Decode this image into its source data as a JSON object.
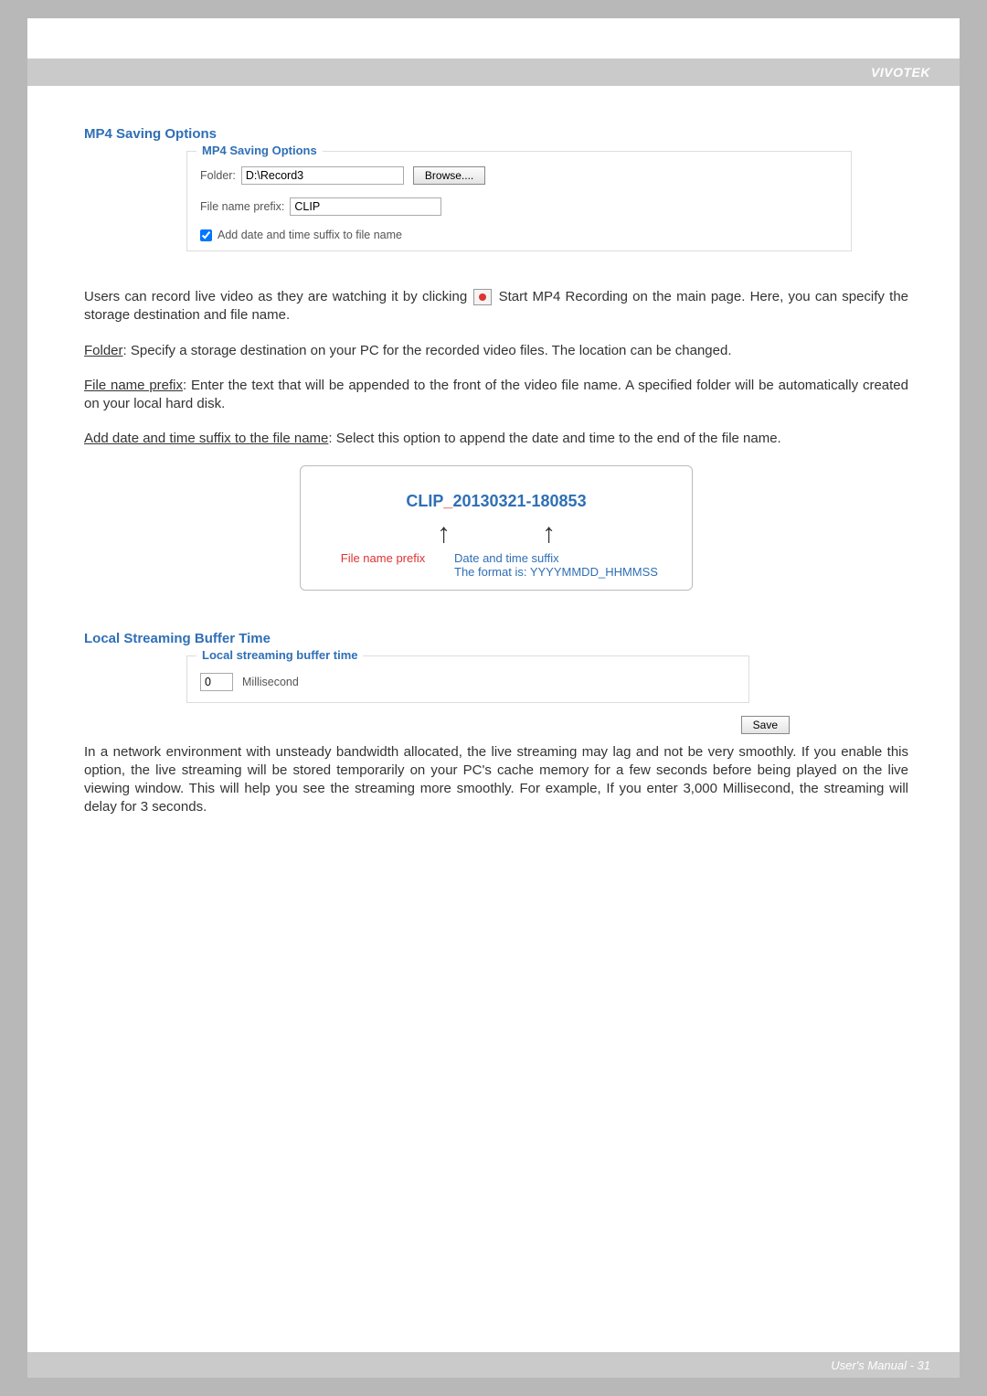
{
  "header": {
    "brand": "VIVOTEK"
  },
  "mp4": {
    "section_title": "MP4 Saving Options",
    "legend": "MP4 Saving Options",
    "folder_label": "Folder:",
    "folder_value": "D:\\Record3",
    "browse_label": "Browse....",
    "prefix_label": "File name prefix:",
    "prefix_value": "CLIP",
    "add_suffix_label": "Add date and time suffix to file name",
    "add_suffix_checked": true
  },
  "para1_a": "Users can record live video as they are watching it by clicking",
  "para1_b": "Start MP4 Recording on the main page. Here, you can specify the storage destination and file name.",
  "para2_label": "Folder",
  "para2_text": ": Specify a storage destination on your PC for the recorded video files. The location can be changed.",
  "para3_label": "File name prefix",
  "para3_text": ": Enter the text that will be appended to the front of the video file name. A specified folder will be automatically created on your local hard disk.",
  "para4_label": "Add date and time suffix to the file name",
  "para4_text": ": Select this option to append the date and time to the end of the file name.",
  "example": {
    "prefix": "CLIP",
    "sep": "_",
    "suffix": "20130321-180853",
    "arrow_prefix_label": "File name prefix",
    "arrow_suffix_line1": "Date and time suffix",
    "arrow_suffix_line2": "The format is: YYYYMMDD_HHMMSS"
  },
  "buffer": {
    "section_title": "Local Streaming Buffer Time",
    "legend": "Local streaming buffer time",
    "value": "0",
    "unit": "Millisecond",
    "save_label": "Save"
  },
  "para5": "In a network environment with unsteady bandwidth allocated, the live streaming may lag and not be very smoothly. If you enable this option, the live streaming will be stored temporarily on your PC's cache memory for a few seconds before being played on the live viewing window. This will help you see the streaming more smoothly. For example, If you enter 3,000 Millisecond, the streaming will delay for 3 seconds.",
  "footer": {
    "text": "User's Manual - 31"
  }
}
